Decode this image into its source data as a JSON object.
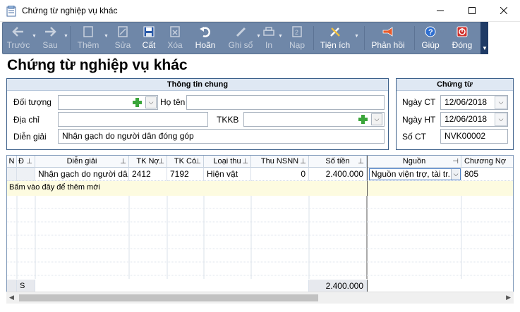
{
  "window": {
    "title": "Chứng từ nghiệp vụ khác"
  },
  "toolbar": {
    "items": [
      {
        "label": "Trước",
        "icon": "arrow-left-icon",
        "enabled": false
      },
      {
        "label": "Sau",
        "icon": "arrow-right-icon",
        "enabled": false
      },
      {
        "label": "Thêm",
        "icon": "new-document-icon",
        "enabled": false
      },
      {
        "label": "Sửa",
        "icon": "edit-document-icon",
        "enabled": false
      },
      {
        "label": "Cất",
        "icon": "save-icon",
        "enabled": true
      },
      {
        "label": "Xóa",
        "icon": "delete-icon",
        "enabled": false
      },
      {
        "label": "Hoãn",
        "icon": "undo-icon",
        "enabled": true
      },
      {
        "label": "Ghi sổ",
        "icon": "pencil-icon",
        "enabled": false
      },
      {
        "label": "In",
        "icon": "printer-icon",
        "enabled": false
      },
      {
        "label": "Nạp",
        "icon": "load-icon",
        "enabled": false
      },
      {
        "label": "Tiện ích",
        "icon": "tools-icon",
        "enabled": true
      },
      {
        "label": "Phản hồi",
        "icon": "megaphone-icon",
        "enabled": true
      },
      {
        "label": "Giúp",
        "icon": "help-icon",
        "enabled": true
      },
      {
        "label": "Đóng",
        "icon": "close-power-icon",
        "enabled": true
      }
    ]
  },
  "page_title": "Chứng từ nghiệp vụ khác",
  "general": {
    "header": "Thông tin chung",
    "doi_tuong_label": "Đối tượng",
    "doi_tuong_value": "",
    "ho_ten_label": "Họ tên",
    "ho_ten_value": "",
    "dia_chi_label": "Địa chỉ",
    "dia_chi_value": "",
    "tkkb_label": "TKKB",
    "tkkb_value": "",
    "dien_giai_label": "Diễn giải",
    "dien_giai_value": "Nhận gạch do người dân đóng góp"
  },
  "voucher": {
    "header": "Chứng từ",
    "ngay_ct_label": "Ngày CT",
    "ngay_ct_value": "12/06/2018",
    "ngay_ht_label": "Ngày HT",
    "ngay_ht_value": "12/06/2018",
    "so_ct_label": "Số CT",
    "so_ct_value": "NVK00002"
  },
  "grid": {
    "columns": [
      "N",
      "Đ",
      "Diễn giải",
      "TK Nợ",
      "TK Có",
      "Loại thu",
      "Thu NSNN",
      "Số tiền",
      "Nguồn",
      "Chương Nợ"
    ],
    "rows": [
      {
        "dien_giai": "Nhận gạch do người dâ...",
        "tk_no": "2412",
        "tk_co": "7192",
        "loai_thu": "Hiện vật",
        "thu_nsnn": "0",
        "so_tien": "2.400.000",
        "nguon": "Nguồn viện trợ, tài tr...",
        "chuong_no": "805"
      }
    ],
    "add_row_text": "Bấm vào đây để thêm mới",
    "total_marker": "S",
    "total_amount": "2.400.000"
  },
  "colors": {
    "toolbar_bg": "#6f87a8",
    "panel_border": "#3b5f8a",
    "add_row_bg": "#fdfbe0"
  }
}
